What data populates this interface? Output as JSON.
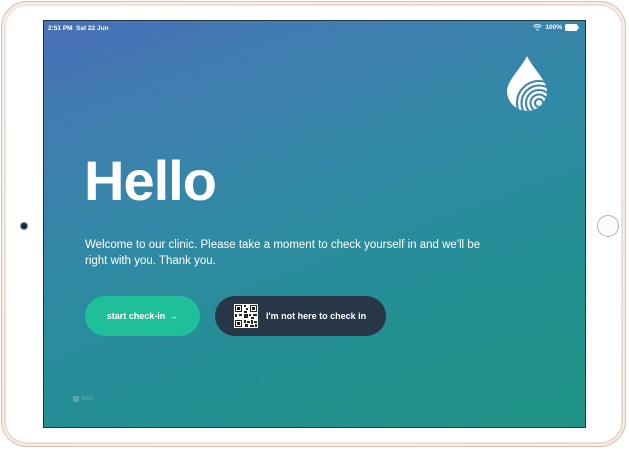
{
  "status_bar": {
    "time": "2:51 PM",
    "date": "Sat 22 Jun",
    "battery": "100%"
  },
  "main": {
    "heading": "Hello",
    "welcome_text": "Welcome to our clinic. Please take a moment to check yourself in and we'll be right with you. Thank you."
  },
  "actions": {
    "start_label": "start check-in",
    "start_arrow": "→",
    "not_here_label": "I'm not here to check in"
  },
  "footer": {
    "exit_label": "exit"
  },
  "colors": {
    "start_button": "#1fbf9a",
    "not_here_button": "#283747",
    "gradient_top": "#4a6fb8",
    "gradient_bottom": "#1f9485"
  },
  "icons": [
    "wifi-icon",
    "battery-icon",
    "water-drop-fingerprint-logo",
    "qr-code-icon",
    "arrow-right-icon"
  ]
}
